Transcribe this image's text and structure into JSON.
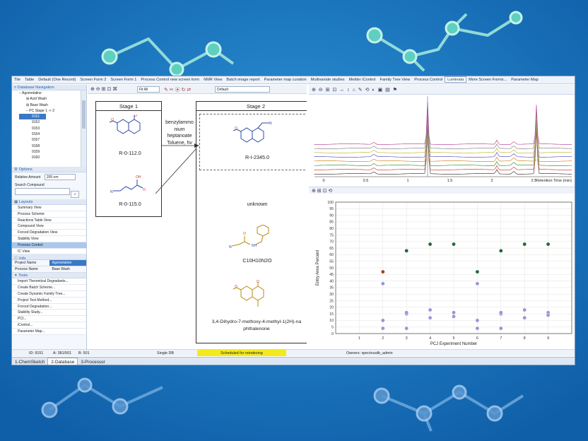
{
  "menu": [
    "Tile",
    "Table",
    "Default (One Record)",
    "Screen Form 2",
    "Screen Form 1",
    "Process Control new screen form",
    "NMR View",
    "Batch image report",
    "Parameter map curation",
    "Multivariate studies",
    "Mettler iControl",
    "Family Tree View",
    "Process Control",
    "Luminata",
    "More Screen Forms...",
    "Parameter Map"
  ],
  "menu_active": "Luminata",
  "nav": {
    "title": "Database Navigation",
    "tree": [
      "Agomelatine",
      "Acid Wash",
      "Base Wash",
      "PC Stage 1 -> 2",
      "9151",
      "9152",
      "9153",
      "9154",
      "9157",
      "9158",
      "9159",
      "9160"
    ],
    "selected": "9151"
  },
  "options": {
    "title": "Options",
    "relative_label": "Relative Amount",
    "relative_value": "205 nm",
    "search_label": "Search Compound"
  },
  "layouts": {
    "title": "Layouts",
    "items": [
      "Summary View",
      "Process Scheme",
      "Reactions Table View",
      "Compound View",
      "Forced Degradation View",
      "Stability View",
      "Process Control",
      "IC View"
    ],
    "selected": "Process Control"
  },
  "info": {
    "title": "Info",
    "rows": [
      [
        "Project Name",
        "Agomelatine"
      ],
      [
        "Process Name",
        "Base Wash"
      ]
    ]
  },
  "tools": {
    "title": "Tools",
    "items": [
      "Import Theoretical Degradants...",
      "Create Batch Scheme...",
      "Create Dynamic Family Tree...",
      "Project Test Method...",
      "Forced Degradation...",
      "Stability Study...",
      "PCI...",
      "iControl...",
      "Parameter Map..."
    ]
  },
  "canvas_toolbar": {
    "zoom": "Fit All",
    "style": "Default"
  },
  "scheme": {
    "stage1": "Stage 1",
    "stage2": "Stage 2",
    "s1_compounds": [
      "R-0-112.0",
      "R-0-115.0"
    ],
    "reagent_lines": [
      "benzylammo",
      "nium",
      "heptanoate",
      "Toluene, hv"
    ],
    "s2_compounds": [
      "R-I-2345.0",
      "unknown",
      "C10H10N2O",
      "3,4-Dihydro-7-methoxy-4-methyl-1(2H)-na",
      "phthalenone"
    ]
  },
  "chromatogram": {
    "xlabel": "Retention Time (min)",
    "xticks": [
      "0",
      "0.5",
      "1",
      "1.5",
      "2",
      "2.5"
    ]
  },
  "chart_data": {
    "type": "scatter",
    "xlabel": "PCJ Experiment Number",
    "ylabel": "Entry Area Percent",
    "xlim": [
      0,
      10
    ],
    "ylim": [
      0,
      100
    ],
    "xticks": [
      1,
      2,
      3,
      4,
      5,
      6,
      7,
      8,
      9
    ],
    "yticks": [
      0,
      5,
      10,
      15,
      20,
      25,
      30,
      35,
      40,
      45,
      50,
      55,
      60,
      65,
      70,
      75,
      80,
      85,
      90,
      95,
      100
    ],
    "grid": true,
    "series": [
      {
        "color": "#1f6b34",
        "points": [
          [
            3,
            63
          ],
          [
            4,
            68
          ],
          [
            5,
            68
          ],
          [
            6,
            47
          ],
          [
            7,
            63
          ],
          [
            8,
            68
          ],
          [
            9,
            68
          ]
        ]
      },
      {
        "color": "#b03a24",
        "points": [
          [
            2,
            47
          ]
        ]
      },
      {
        "color": "#9d94d6",
        "points": [
          [
            2,
            38
          ],
          [
            2,
            10
          ],
          [
            2,
            4
          ],
          [
            3,
            15
          ],
          [
            3,
            16
          ],
          [
            3,
            4
          ],
          [
            4,
            18
          ],
          [
            4,
            12
          ],
          [
            5,
            16
          ],
          [
            5,
            13
          ],
          [
            6,
            38
          ],
          [
            6,
            10
          ],
          [
            6,
            4
          ],
          [
            7,
            15
          ],
          [
            7,
            16
          ],
          [
            7,
            4
          ],
          [
            8,
            18
          ],
          [
            8,
            12
          ],
          [
            9,
            16
          ],
          [
            9,
            14
          ]
        ]
      }
    ]
  },
  "status": {
    "id": "ID: 9151",
    "a": "A: 381/501",
    "b": "B: 501",
    "db": "Single DB",
    "reindex": "Scheduled for reindexing",
    "owners": "Owners: spectrusdb_admin"
  },
  "tabs": [
    "1-ChemSketch",
    "2-Database",
    "3-Processor"
  ],
  "tab_active": "2-Database"
}
